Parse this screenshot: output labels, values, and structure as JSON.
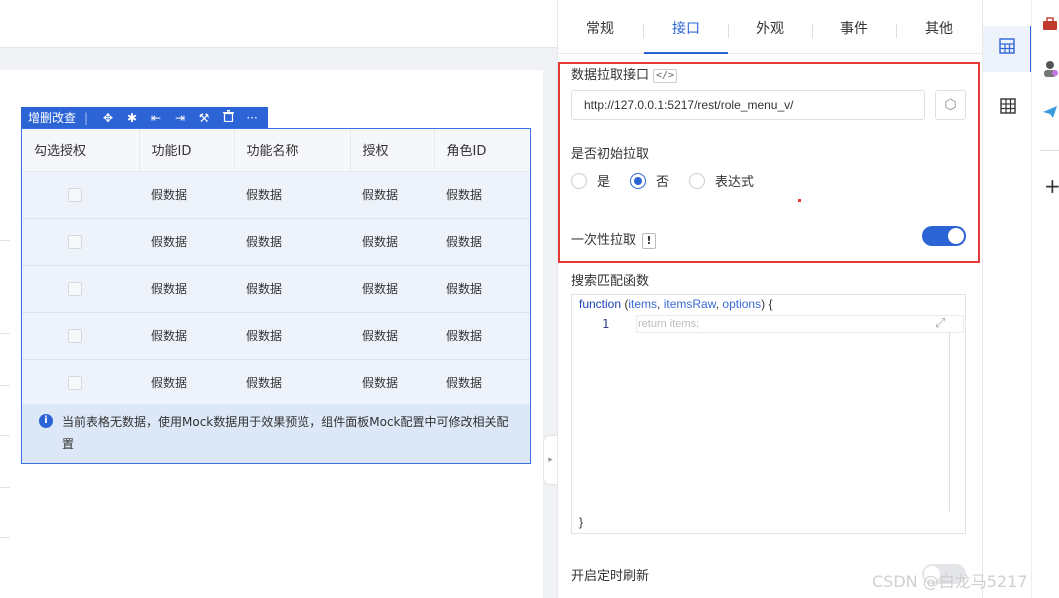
{
  "toolbar": {
    "label": "增删改查",
    "separator": "|",
    "icons": [
      "move-icon",
      "bug-icon",
      "align-left-icon",
      "align-right-icon",
      "hammer-icon",
      "trash-icon",
      "more-icon"
    ],
    "icon_glyphs": {
      "move": "✥",
      "bug": "✱",
      "align_left": "⇤",
      "align_right": "⇥",
      "hammer": "⚒",
      "trash": "🗑",
      "more": "···"
    }
  },
  "table": {
    "columns": [
      "勾选授权",
      "功能ID",
      "功能名称",
      "授权",
      "角色ID"
    ],
    "rows": [
      [
        "",
        "假数据",
        "假数据",
        "假数据",
        "假数据"
      ],
      [
        "",
        "假数据",
        "假数据",
        "假数据",
        "假数据"
      ],
      [
        "",
        "假数据",
        "假数据",
        "假数据",
        "假数据"
      ],
      [
        "",
        "假数据",
        "假数据",
        "假数据",
        "假数据"
      ],
      [
        "",
        "假数据",
        "假数据",
        "假数据",
        "假数据"
      ]
    ],
    "mock_note": "当前表格无数据，使用Mock数据用于效果预览，组件面板Mock配置中可修改相关配置",
    "info_glyph": "i"
  },
  "panel": {
    "tabs": [
      "常规",
      "接口",
      "外观",
      "事件",
      "其他"
    ],
    "active_tab": "接口",
    "fetch_api_label": "数据拉取接口",
    "code_tag": "</>",
    "url_value": "http://127.0.0.1:5217/rest/role_menu_v/",
    "initial_fetch_label": "是否初始拉取",
    "radio_options": [
      "是",
      "否",
      "表达式"
    ],
    "radio_selected": "否",
    "one_time_label": "一次性拉取",
    "warn_glyph": "!",
    "one_time_enabled": true,
    "search_match_label": "搜索匹配函数",
    "editor": {
      "keyword": "function",
      "params": [
        "items",
        "itemsRaw",
        "options"
      ],
      "line_number": "1",
      "placeholder": "return items;",
      "closing": "}",
      "expand_glyph": "⤢"
    },
    "auto_refresh_label": "开启定时刷新",
    "auto_refresh_enabled": false,
    "settings_glyph": "⬡"
  },
  "rail": {
    "icons": [
      "table-settings-icon",
      "table-grid-icon"
    ],
    "glyphs": [
      "▦",
      "▦"
    ]
  },
  "collapse_glyph": "▸",
  "watermark": "CSDN @白龙马5217",
  "colors": {
    "accent": "#2c64d6",
    "highlight": "#e53935"
  }
}
